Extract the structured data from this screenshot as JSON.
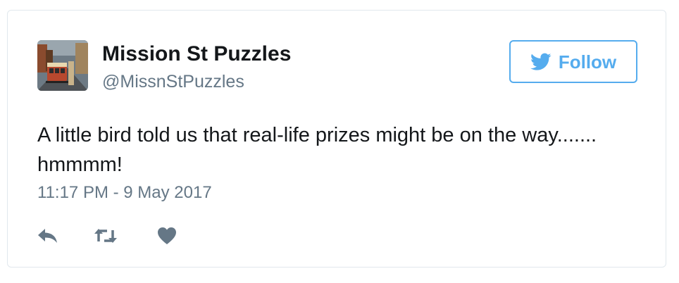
{
  "tweet": {
    "author_name": "Mission St Puzzles",
    "author_handle": "@MissnStPuzzles",
    "follow_label": "Follow",
    "text": "A little bird told us that real-life prizes might be on the way....... hmmmm!",
    "timestamp": "11:17 PM - 9 May 2017"
  },
  "icons": {
    "avatar": "cable-car-photo",
    "follow": "twitter-bird-icon",
    "reply": "reply-icon",
    "retweet": "retweet-icon",
    "like": "heart-icon"
  },
  "colors": {
    "accent": "#55acee",
    "text": "#14171a",
    "secondary": "#657786",
    "border": "#e1e8ed"
  }
}
